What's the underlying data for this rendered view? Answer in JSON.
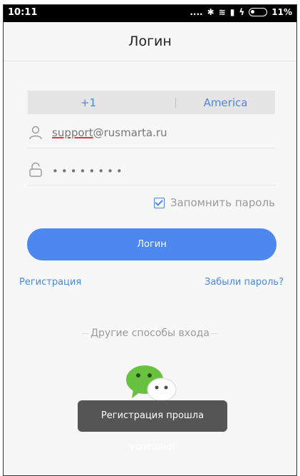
{
  "status_bar": {
    "time": "10:11",
    "signal_text": "....",
    "battery_percent": "11%"
  },
  "header": {
    "title": "Логин"
  },
  "country": {
    "code": "+1",
    "name": "America"
  },
  "fields": {
    "username_prefix": "support",
    "username_suffix": "@rusmarta.ru",
    "password_mask": "••••••••"
  },
  "remember": {
    "label": "Запомнить пароль",
    "checked": true
  },
  "login_button": {
    "label": "Логин"
  },
  "links": {
    "register": "Регистрация",
    "forgot": "Забыли пароль?"
  },
  "other_methods": {
    "label": "Другие способы входа",
    "icon": "wechat-icon"
  },
  "toast": {
    "message": "Регистрация прошла успешно!"
  },
  "colors": {
    "accent": "#4d88f0",
    "link": "#4b86e5",
    "toast_bg": "#555555",
    "wechat_green": "#68c23f"
  }
}
